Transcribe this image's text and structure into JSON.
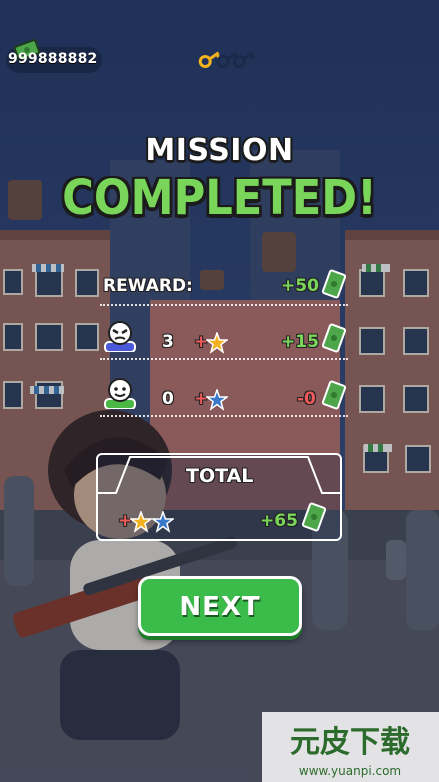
{
  "hud": {
    "cash": "999888882",
    "keys_collected": 1,
    "keys_total": 3
  },
  "title": {
    "line1": "MISSION",
    "line2": "COMPLETED!"
  },
  "reward_row": {
    "label": "REWARD:",
    "amount": "+50"
  },
  "enemy_row": {
    "count": "3",
    "plus": "+",
    "amount": "+15"
  },
  "civilian_row": {
    "count": "0",
    "plus": "+",
    "amount": "-0"
  },
  "total": {
    "label": "TOTAL",
    "plus": "+",
    "amount": "+65"
  },
  "next_button": {
    "label": "NEXT"
  },
  "watermark": {
    "brand": "元皮下载",
    "url": "www.yuanpi.com"
  },
  "colors": {
    "accent_green": "#7ad65a",
    "button_green": "#3bbb4a",
    "negative_red": "#ef5a5a",
    "key_gold": "#f3b21e"
  },
  "icons": {
    "cash": "cash-bill-icon",
    "key": "key-icon",
    "enemy": "enemy-face-icon",
    "civilian": "civilian-face-icon",
    "gold_star": "gold-star-icon",
    "blue_star": "blue-star-icon"
  }
}
